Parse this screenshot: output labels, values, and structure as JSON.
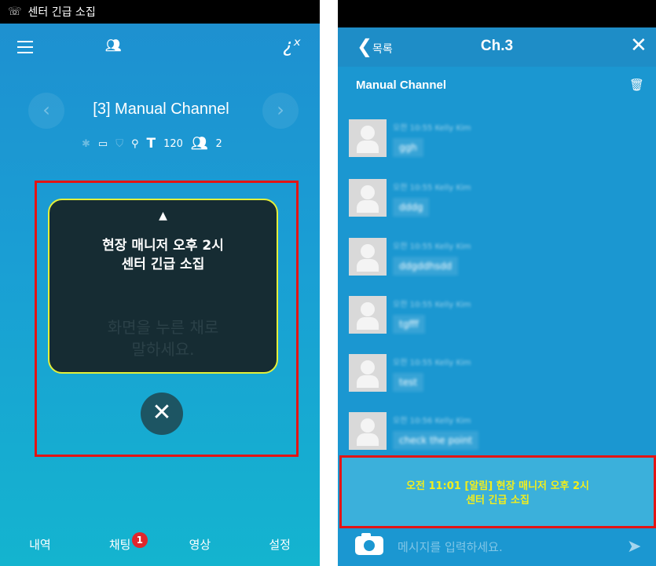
{
  "left": {
    "status_bar": {
      "notification_text": "센터 긴급 소집"
    },
    "channel": {
      "title": "[3] Manual Channel",
      "tx_value": "120",
      "member_count": "2"
    },
    "alert": {
      "message": "현장 매니저 오후 2시\n센터 긴급 소집",
      "hint": "화면을 누른 채로\n말하세요."
    },
    "bottom_nav": {
      "tabs": [
        "내역",
        "채팅",
        "영상",
        "설정"
      ],
      "chat_badge": "1"
    }
  },
  "right": {
    "header": {
      "back_label": "목록",
      "title": "Ch.3"
    },
    "channel_name": "Manual Channel",
    "messages": [
      {
        "meta": "오전 10:55 Kelly Kim",
        "text": "ggh"
      },
      {
        "meta": "오전 10:55 Kelly Kim",
        "text": "dddg"
      },
      {
        "meta": "오전 10:55 Kelly Kim",
        "text": "ddgddhsdd"
      },
      {
        "meta": "오전 10:55 Kelly Kim",
        "text": "tgfff"
      },
      {
        "meta": "오전 10:55 Kelly Kim",
        "text": "test"
      },
      {
        "meta": "오전 10:56 Kelly Kim",
        "text": "check the point"
      }
    ],
    "notice": "오전 11:01 [알림] 현장 매니저 오후 2시\n센터 긴급 소집",
    "input_placeholder": "메시지를 입력하세요."
  },
  "colors": {
    "alert_border": "#e4f03a",
    "highlight_box": "#e31414",
    "notice_text": "#f2ee1c",
    "badge": "#e0262c"
  }
}
